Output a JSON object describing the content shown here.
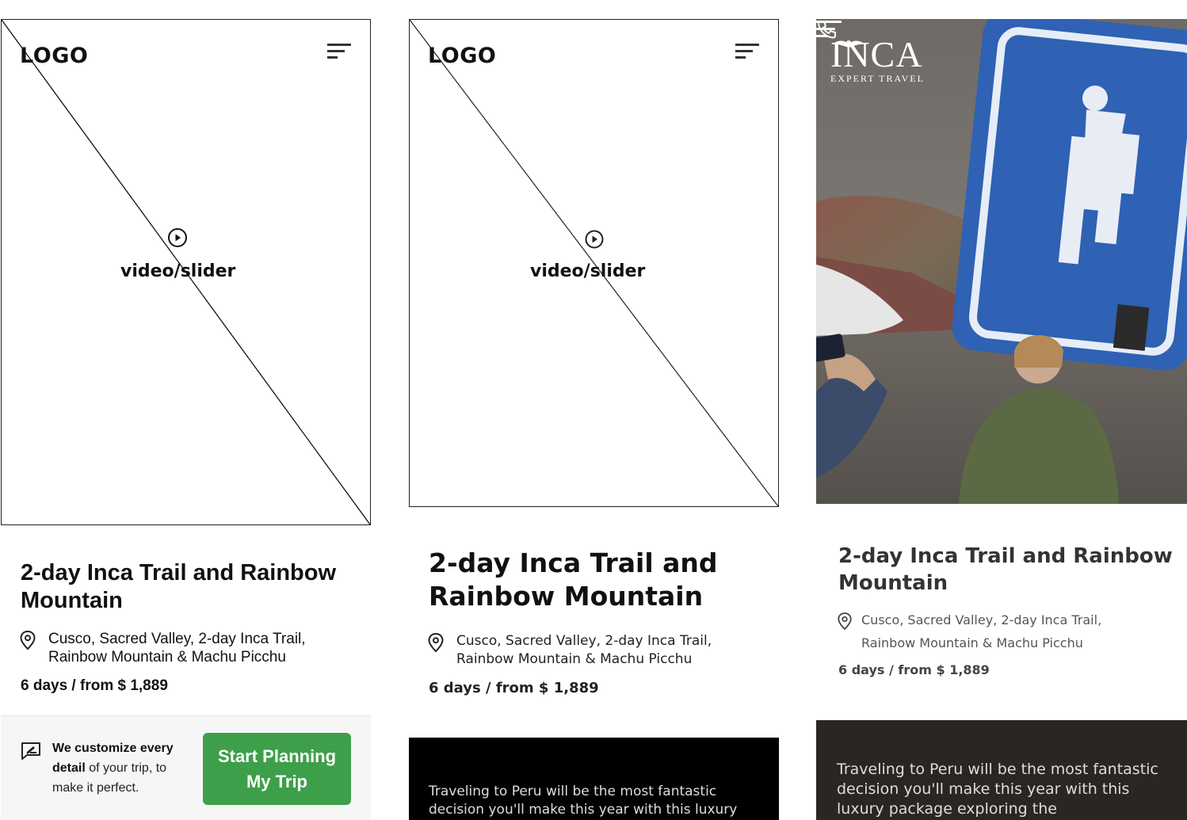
{
  "wireframe": {
    "logo": "LOGO",
    "media_label": "video/slider"
  },
  "brand": {
    "name": "INCA",
    "tagline": "EXPERT TRAVEL"
  },
  "trip": {
    "title": "2-day Inca Trail and Rainbow Mountain",
    "location_line1": "Cusco, Sacred Valley, 2-day Inca Trail,",
    "location_line2": "Rainbow Mountain & Machu Picchu",
    "price": "6 days / from $ 1,889"
  },
  "cta": {
    "text_bold1": "We customize every",
    "text_bold2": "detail",
    "text_rest1": " of your trip, to",
    "text_rest2": "make it perfect.",
    "button_line1": "Start Planning",
    "button_line2": "My Trip"
  },
  "intro": {
    "wire_text": "Traveling to Peru will be the most fantastic decision you'll make this year with this luxury",
    "final_text": "Traveling to Peru will be the most fantastic decision you'll make this year with this luxury package exploring the"
  },
  "colors": {
    "cta_green": "#3e9f4a",
    "dark_bar": "#000000",
    "dark_bar_final": "#2a2623"
  },
  "icons": [
    "menu-icon",
    "play-circle-icon",
    "location-pin-icon",
    "phone-icon",
    "chat-edit-icon"
  ]
}
